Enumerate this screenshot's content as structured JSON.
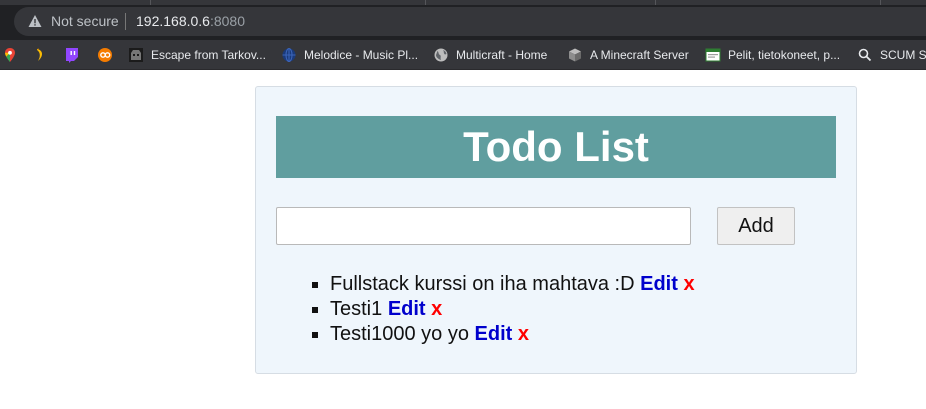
{
  "browser": {
    "security_label": "Not secure",
    "url_host": "192.168.0.6",
    "url_port": ":8080",
    "bookmarks": [
      {
        "label": "",
        "icon": "google-maps-icon"
      },
      {
        "label": "",
        "icon": "banana-icon"
      },
      {
        "label": "",
        "icon": "twitch-icon"
      },
      {
        "label": "",
        "icon": "orange-circle-icon"
      },
      {
        "label": "Escape from Tarkov...",
        "icon": "tarkov-icon"
      },
      {
        "label": "Melodice - Music Pl...",
        "icon": "globe-icon"
      },
      {
        "label": "Multicraft - Home",
        "icon": "globe-icon"
      },
      {
        "label": "A Minecraft Server",
        "icon": "minecraft-block-icon"
      },
      {
        "label": "Pelit, tietokoneet, p...",
        "icon": "verkkokauppa-icon"
      },
      {
        "label": "SCUM Se",
        "icon": "search-icon"
      }
    ]
  },
  "page": {
    "title": "Todo List",
    "input": {
      "value": "",
      "placeholder": ""
    },
    "add_label": "Add",
    "edit_label": "Edit",
    "delete_label": "x",
    "todos": [
      {
        "text": "Fullstack kurssi on iha mahtava :D"
      },
      {
        "text": "Testi1"
      },
      {
        "text": "Testi1000 yo yo"
      }
    ]
  },
  "colors": {
    "title_bg": "#609e9f",
    "card_bg": "#eff6fc",
    "edit_link": "#0000cc",
    "delete_link": "#ff0000"
  }
}
